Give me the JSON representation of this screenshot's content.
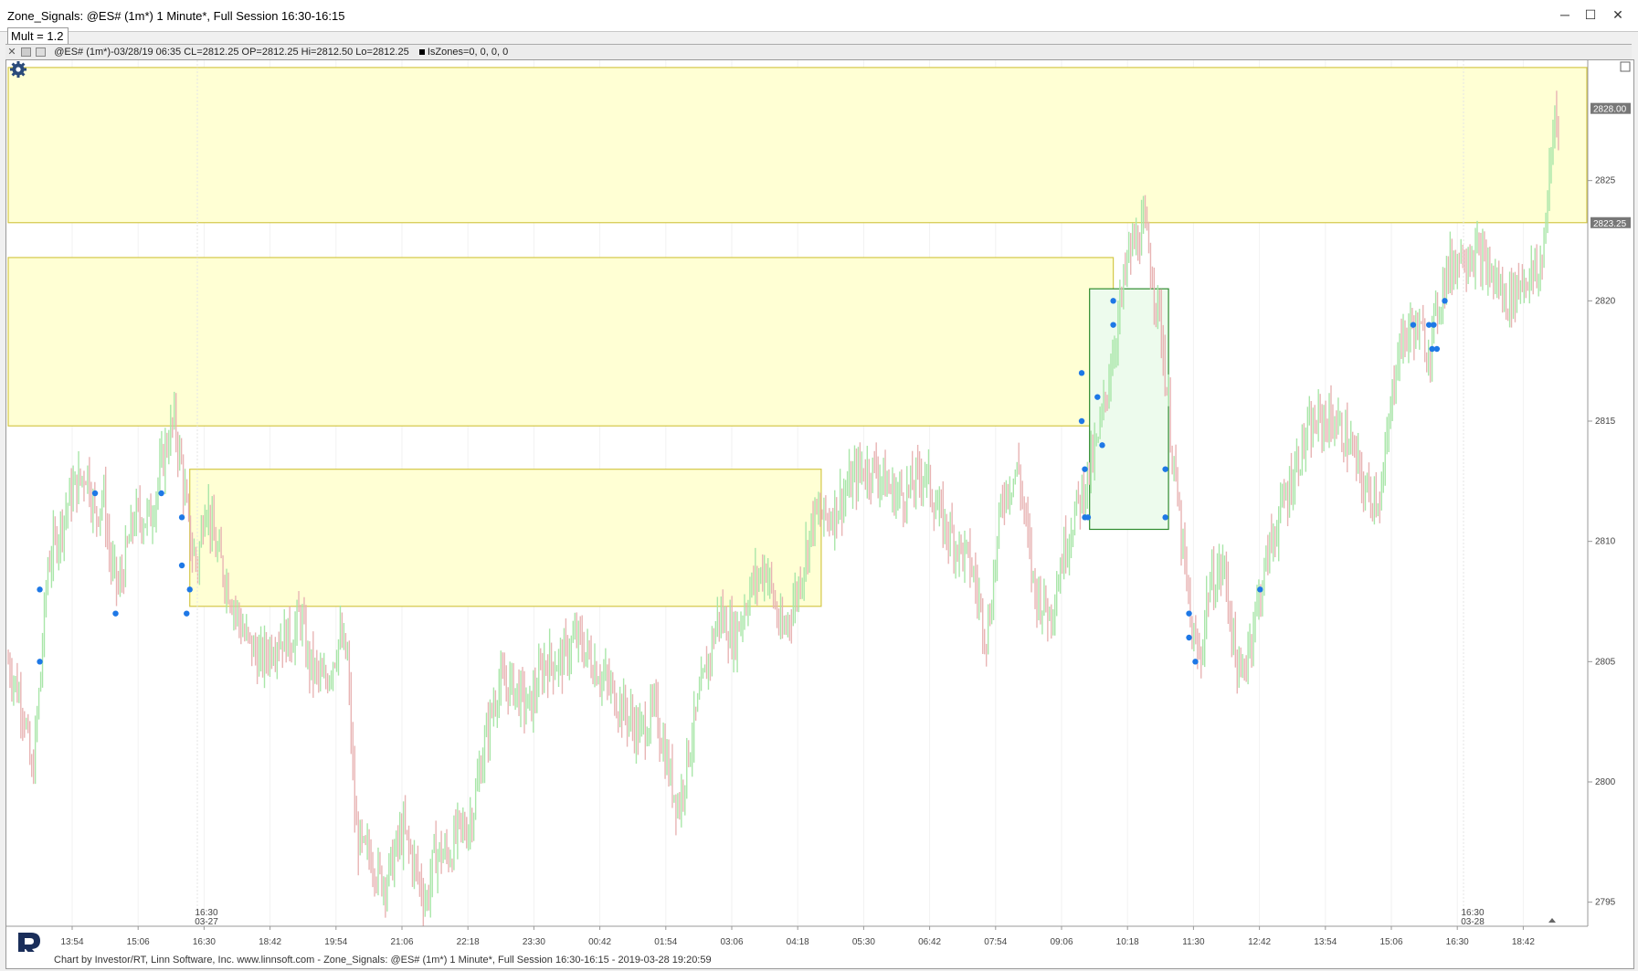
{
  "window": {
    "title": "Zone_Signals: @ES# (1m*) 1 Minute*, Full Session 16:30-16:15",
    "minimize": "─",
    "maximize": "☐",
    "close": "✕"
  },
  "input": {
    "mult": "Mult = 1.2"
  },
  "info_bar": {
    "close_glyph": "✕",
    "text": "@ES# (1m*)-03/28/19 06:35 CL=2812.25 OP=2812.25 Hi=2812.50 Lo=2812.25",
    "indicator": "IsZones=0, 0, 0, 0"
  },
  "icons": {
    "settings": "gear-icon",
    "logo": "rt-logo"
  },
  "footer": {
    "text": "Chart by Investor/RT, Linn Software, Inc. www.linnsoft.com - Zone_Signals: @ES# (1m*) 1 Minute*, Full Session 16:30-16:15 - 2019-03-28 19:20:59"
  },
  "colors": {
    "zone_fill": "#ffffd4",
    "zone_border": "#d4c84a",
    "green_zone_fill": "#edfbed",
    "green_zone_border": "#2e8b2e",
    "up_bar": "#a9e6a9",
    "down_bar": "#e8b4b4",
    "signal_dot": "#1e78e6",
    "tag_bg": "#777777"
  },
  "chart_data": {
    "type": "candlestick",
    "y_axis": {
      "min": 2794,
      "max": 2830,
      "ticks": [
        2795,
        2800,
        2805,
        2810,
        2815,
        2820,
        2825
      ],
      "tick_labels": [
        "2795",
        "2800",
        "2805",
        "2810",
        "2815",
        "2820",
        "2825"
      ],
      "price_tags": [
        {
          "value": 2828.0,
          "label": "2828.00"
        },
        {
          "value": 2823.25,
          "label": "2823.25"
        }
      ]
    },
    "x_axis": {
      "tick_labels": [
        "13:54",
        "15:06",
        "16:30",
        "18:42",
        "19:54",
        "21:06",
        "22:18",
        "23:30",
        "00:42",
        "01:54",
        "03:06",
        "04:18",
        "05:30",
        "06:42",
        "07:54",
        "09:06",
        "10:18",
        "11:30",
        "12:42",
        "13:54",
        "15:06",
        "16:30",
        "18:42"
      ],
      "session_markers": [
        {
          "time": "16:30",
          "date": "03-27"
        },
        {
          "time": "16:30",
          "date": "03-28"
        }
      ]
    },
    "zones": [
      {
        "kind": "supply",
        "top": 2829.7,
        "bottom": 2823.25,
        "from": 0.0,
        "to": 1.0
      },
      {
        "kind": "supply",
        "top": 2821.8,
        "bottom": 2814.8,
        "from": 0.0,
        "to": 0.7
      },
      {
        "kind": "supply",
        "top": 2813.0,
        "bottom": 2807.3,
        "from": 0.115,
        "to": 0.515
      },
      {
        "kind": "active",
        "top": 2820.5,
        "bottom": 2810.5,
        "from": 0.685,
        "to": 0.735
      }
    ],
    "price_path": [
      [
        0.0,
        2805
      ],
      [
        0.01,
        2803
      ],
      [
        0.015,
        2800
      ],
      [
        0.02,
        2804
      ],
      [
        0.025,
        2809
      ],
      [
        0.03,
        2810
      ],
      [
        0.04,
        2812
      ],
      [
        0.05,
        2813
      ],
      [
        0.055,
        2811
      ],
      [
        0.06,
        2812
      ],
      [
        0.065,
        2809
      ],
      [
        0.07,
        2808
      ],
      [
        0.08,
        2811
      ],
      [
        0.09,
        2811
      ],
      [
        0.1,
        2814
      ],
      [
        0.105,
        2815
      ],
      [
        0.11,
        2813
      ],
      [
        0.115,
        2810
      ],
      [
        0.12,
        2809
      ],
      [
        0.125,
        2812
      ],
      [
        0.13,
        2810
      ],
      [
        0.14,
        2808
      ],
      [
        0.15,
        2806
      ],
      [
        0.16,
        2805
      ],
      [
        0.17,
        2806
      ],
      [
        0.18,
        2806
      ],
      [
        0.185,
        2807
      ],
      [
        0.19,
        2805
      ],
      [
        0.2,
        2804
      ],
      [
        0.21,
        2806
      ],
      [
        0.215,
        2805
      ],
      [
        0.22,
        2798
      ],
      [
        0.225,
        2797
      ],
      [
        0.23,
        2797
      ],
      [
        0.235,
        2796
      ],
      [
        0.24,
        2796
      ],
      [
        0.25,
        2798
      ],
      [
        0.255,
        2797
      ],
      [
        0.26,
        2796
      ],
      [
        0.265,
        2795
      ],
      [
        0.27,
        2797
      ],
      [
        0.28,
        2797
      ],
      [
        0.285,
        2798
      ],
      [
        0.29,
        2798
      ],
      [
        0.295,
        2799
      ],
      [
        0.3,
        2801
      ],
      [
        0.31,
        2804
      ],
      [
        0.32,
        2804
      ],
      [
        0.33,
        2803
      ],
      [
        0.34,
        2805
      ],
      [
        0.35,
        2805
      ],
      [
        0.36,
        2806
      ],
      [
        0.37,
        2805
      ],
      [
        0.38,
        2804
      ],
      [
        0.39,
        2803
      ],
      [
        0.4,
        2802
      ],
      [
        0.41,
        2803
      ],
      [
        0.42,
        2800
      ],
      [
        0.425,
        2799
      ],
      [
        0.43,
        2801
      ],
      [
        0.44,
        2804
      ],
      [
        0.45,
        2807
      ],
      [
        0.46,
        2806
      ],
      [
        0.47,
        2808
      ],
      [
        0.48,
        2809
      ],
      [
        0.49,
        2806
      ],
      [
        0.5,
        2808
      ],
      [
        0.51,
        2811
      ],
      [
        0.52,
        2811
      ],
      [
        0.53,
        2812
      ],
      [
        0.54,
        2813
      ],
      [
        0.55,
        2813
      ],
      [
        0.56,
        2812
      ],
      [
        0.57,
        2812
      ],
      [
        0.58,
        2813
      ],
      [
        0.59,
        2811
      ],
      [
        0.6,
        2810
      ],
      [
        0.61,
        2809
      ],
      [
        0.62,
        2806
      ],
      [
        0.63,
        2812
      ],
      [
        0.64,
        2813
      ],
      [
        0.65,
        2808
      ],
      [
        0.66,
        2807
      ],
      [
        0.67,
        2810
      ],
      [
        0.68,
        2812
      ],
      [
        0.69,
        2814
      ],
      [
        0.7,
        2818
      ],
      [
        0.71,
        2822
      ],
      [
        0.72,
        2823
      ],
      [
        0.73,
        2819
      ],
      [
        0.74,
        2812
      ],
      [
        0.75,
        2806
      ],
      [
        0.755,
        2805
      ],
      [
        0.76,
        2808
      ],
      [
        0.77,
        2809
      ],
      [
        0.78,
        2804
      ],
      [
        0.79,
        2807
      ],
      [
        0.8,
        2810
      ],
      [
        0.81,
        2812
      ],
      [
        0.82,
        2814
      ],
      [
        0.83,
        2815
      ],
      [
        0.84,
        2815
      ],
      [
        0.85,
        2814
      ],
      [
        0.86,
        2812
      ],
      [
        0.87,
        2812
      ],
      [
        0.88,
        2818
      ],
      [
        0.89,
        2819
      ],
      [
        0.9,
        2818
      ],
      [
        0.91,
        2821
      ],
      [
        0.92,
        2822
      ],
      [
        0.93,
        2822
      ],
      [
        0.94,
        2821
      ],
      [
        0.95,
        2820
      ],
      [
        0.96,
        2821
      ],
      [
        0.97,
        2821
      ],
      [
        0.975,
        2824
      ],
      [
        0.98,
        2828
      ],
      [
        0.982,
        2827
      ]
    ],
    "signals": [
      [
        0.02,
        2805
      ],
      [
        0.02,
        2808
      ],
      [
        0.055,
        2812
      ],
      [
        0.068,
        2807
      ],
      [
        0.097,
        2812
      ],
      [
        0.11,
        2811
      ],
      [
        0.11,
        2809
      ],
      [
        0.113,
        2807
      ],
      [
        0.115,
        2808
      ],
      [
        0.68,
        2815
      ],
      [
        0.68,
        2817
      ],
      [
        0.682,
        2813
      ],
      [
        0.682,
        2811
      ],
      [
        0.684,
        2811
      ],
      [
        0.69,
        2816
      ],
      [
        0.693,
        2814
      ],
      [
        0.7,
        2820
      ],
      [
        0.7,
        2819
      ],
      [
        0.733,
        2813
      ],
      [
        0.733,
        2811
      ],
      [
        0.748,
        2807
      ],
      [
        0.748,
        2806
      ],
      [
        0.752,
        2805
      ],
      [
        0.793,
        2808
      ],
      [
        0.89,
        2819
      ],
      [
        0.9,
        2819
      ],
      [
        0.902,
        2818
      ],
      [
        0.903,
        2819
      ],
      [
        0.905,
        2818
      ],
      [
        0.91,
        2820
      ]
    ]
  }
}
